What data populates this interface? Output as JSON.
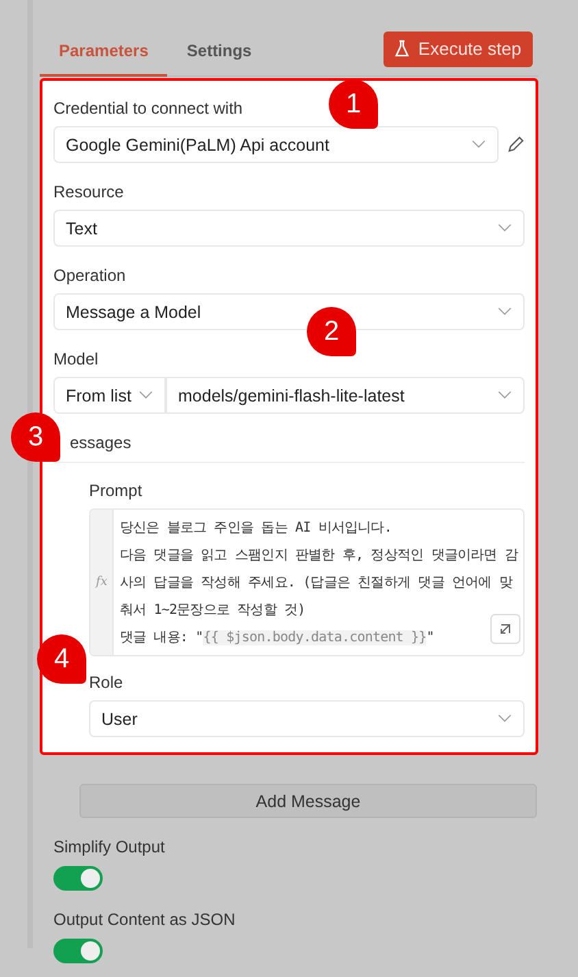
{
  "tabs": [
    {
      "label": "Parameters",
      "selected": true
    },
    {
      "label": "Settings",
      "selected": false
    }
  ],
  "execute_button": "Execute step",
  "fields": [
    {
      "label": "Credential to connect with",
      "value": "Google Gemini(PaLM) Api account",
      "editable": true
    },
    {
      "label": "Resource",
      "value": "Text",
      "editable": false
    },
    {
      "label": "Operation",
      "value": "Message a Model",
      "editable": false
    }
  ],
  "model": {
    "label": "Model",
    "mode": "From list",
    "value": "models/gemini-flash-lite-latest"
  },
  "messages": {
    "label": "essages",
    "prompt_label": "Prompt",
    "prompt_lines": [
      {
        "text": "당신은 블로그 주인을 돕는 AI 비서입니다."
      },
      {
        "text": "다음 댓글을 읽고 스팸인지 판별한 후, 정상적인 댓글이라면 감"
      },
      {
        "text": "사의 답글을 작성해 주세요. (답글은 친절하게 댓글 언어에 맞"
      },
      {
        "text": "춰서 1~2문장으로 작성할 것)"
      },
      {
        "text": "댓글 내용: \"",
        "expression": "{{ $json.body.data.content }}",
        "after": "\""
      }
    ],
    "fx_label": "fx",
    "role_label": "Role",
    "role": "User"
  },
  "add_button": "Add Message",
  "toggles": [
    {
      "label": "Simplify Output",
      "on": true
    },
    {
      "label": "Output Content as JSON",
      "on": true
    }
  ],
  "callouts": [
    "1",
    "2",
    "3",
    "4"
  ]
}
